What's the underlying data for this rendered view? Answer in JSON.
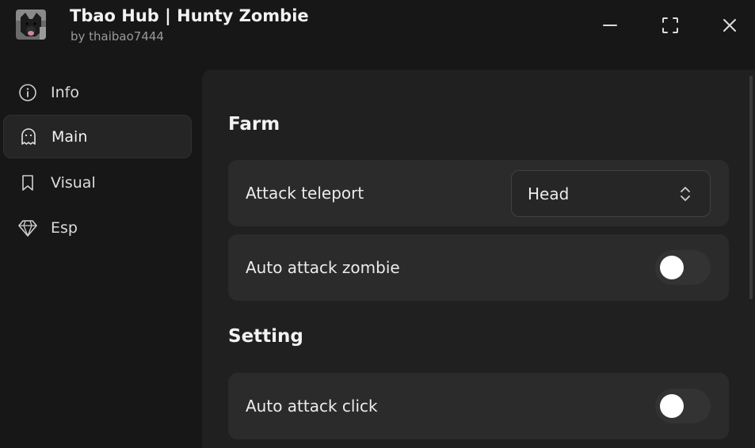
{
  "window": {
    "title": "Tbao Hub | Hunty Zombie",
    "subtitle": "by thaibao7444",
    "avatar_icon": "dog-avatar",
    "controls": [
      "minimize-icon",
      "maximize-icon",
      "close-icon"
    ]
  },
  "sidebar": {
    "items": [
      {
        "label": "Info",
        "icon": "info-icon",
        "active": false
      },
      {
        "label": "Main",
        "icon": "ghost-icon",
        "active": true
      },
      {
        "label": "Visual",
        "icon": "bookmark-icon",
        "active": false
      },
      {
        "label": "Esp",
        "icon": "diamond-icon",
        "active": false
      }
    ]
  },
  "main": {
    "sections": [
      {
        "title": "Farm",
        "rows": [
          {
            "label": "Attack teleport",
            "control": "dropdown",
            "value": "Head"
          },
          {
            "label": "Auto attack zombie",
            "control": "toggle",
            "on": false
          }
        ]
      },
      {
        "title": "Setting",
        "rows": [
          {
            "label": "Auto attack click",
            "control": "toggle",
            "on": false
          }
        ]
      }
    ]
  },
  "colors": {
    "background": "#171717",
    "panel": "#202020",
    "row": "#2b2b2b",
    "text": "#ececec",
    "muted": "#9a9a9a",
    "toggle_track": "#333333",
    "toggle_knob": "#ffffff"
  }
}
